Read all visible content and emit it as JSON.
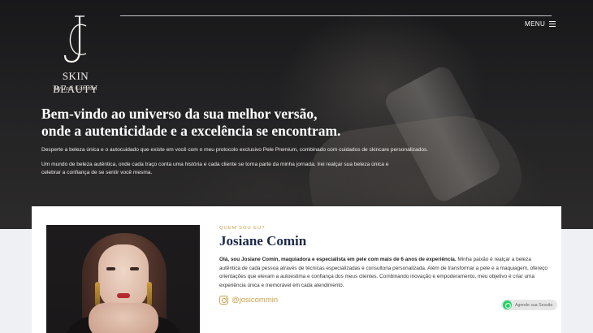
{
  "header": {
    "logo_name": "SKIN BEAUTY",
    "logo_by": "By Josi Commin",
    "menu_label": "MENU"
  },
  "hero": {
    "title_line1": "Bem-vindo ao universo da sua melhor versão,",
    "title_line2": "onde a autenticidade e a excelência se encontram.",
    "paragraph1": "Desperte a beleza única e o autocuidado que existe em você com o meu protocolo exclusivo Pele Premium, combinado com cuidados de skincare personalizados.",
    "paragraph2": "Um mundo de beleza autêntica, onde cada traço conta uma história e cada cliente se torna parte da minha jornada. Irei realçar sua beleza única e celebrar a confiança de se sentir você mesma."
  },
  "about": {
    "eyebrow": "QUEM SOU EU?",
    "name": "Josiane Comin",
    "bio_strong": "Olá, sou Josiane Comin, maquiadora e especialista em pele com mais de 6 anos de experiência.",
    "bio_rest": " Minha paixão é realçar a beleza autêntica de cada pessoa através de técnicas especializadas e consultoria personalizada. Além de transformar a pele e a maquiagem, ofereço orientações que elevam a autoestima e confiança dos meus clientes. Combinando inovação e empoderamento, meu objetivo é criar uma experiência única e memorável em cada atendimento.",
    "instagram_handle": "@josicommin"
  },
  "whatsapp": {
    "label": "Agende sua Sessão"
  },
  "colors": {
    "accent_gold": "#c9a04a",
    "name_navy": "#1d2a4a",
    "whatsapp_green": "#25d366"
  }
}
